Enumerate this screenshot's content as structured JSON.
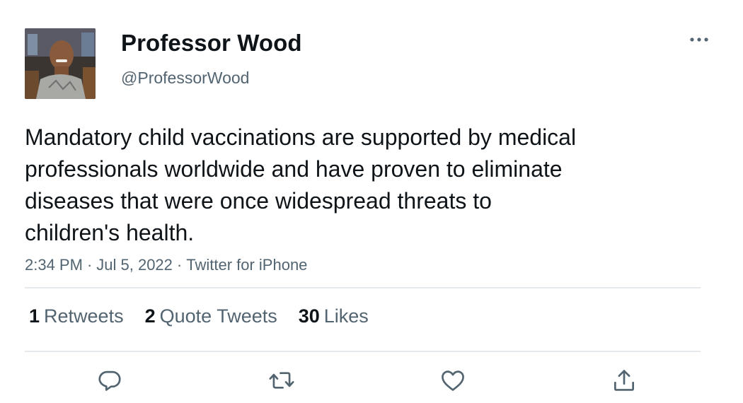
{
  "author": {
    "display_name": "Professor Wood",
    "handle": "@ProfessorWood",
    "avatar_icon": "profile-photo"
  },
  "tweet": {
    "text_lines": [
      "Mandatory child vaccinations are supported by medical",
      "professionals worldwide and have proven to eliminate",
      "diseases that were once widespread threats to",
      "children's health."
    ]
  },
  "meta": {
    "time": "2:34 PM",
    "date": "Jul 5, 2022",
    "source": "Twitter for iPhone",
    "separator": "·"
  },
  "stats": {
    "retweets": {
      "count": "1",
      "label": "Retweets"
    },
    "quote_tweets": {
      "count": "2",
      "label": "Quote Tweets"
    },
    "likes": {
      "count": "30",
      "label": "Likes"
    }
  },
  "actions": [
    "reply-icon",
    "retweet-icon",
    "like-icon",
    "share-icon"
  ],
  "colors": {
    "primary_text": "#0f1419",
    "secondary_text": "#536471",
    "divider": "#e6e9eb"
  }
}
